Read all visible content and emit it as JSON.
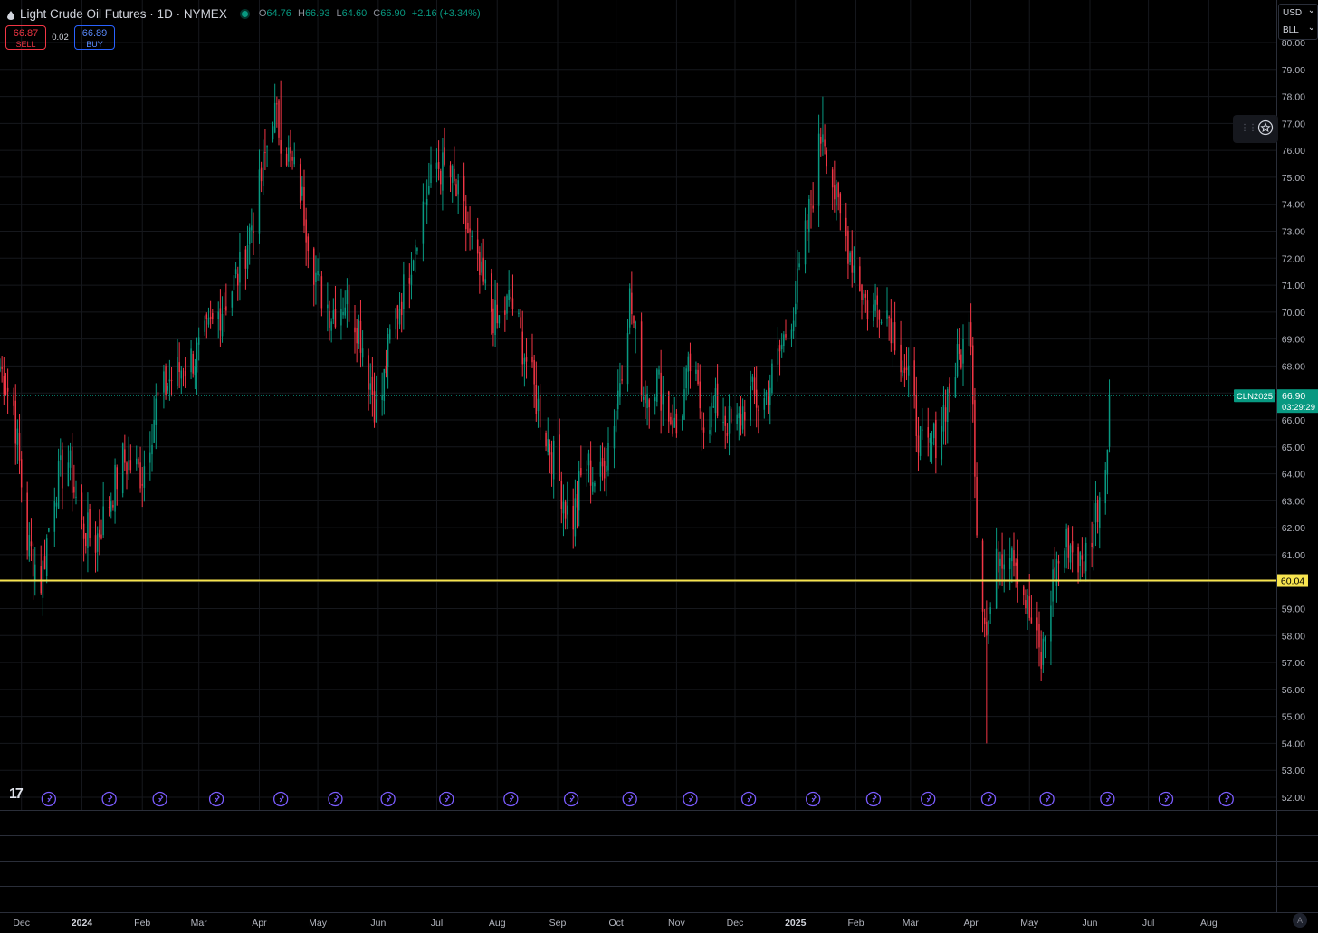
{
  "header": {
    "symbol_title": "Light Crude Oil Futures · 1D · NYMEX",
    "ohlc": {
      "o_key": "O",
      "o": "64.76",
      "h_key": "H",
      "h": "66.93",
      "l_key": "L",
      "l": "64.60",
      "c_key": "C",
      "c": "66.90",
      "change": "+2.16 (+3.34%)"
    }
  },
  "trade": {
    "sell_price": "66.87",
    "sell_label": "SELL",
    "spread": "0.02",
    "buy_price": "66.89",
    "buy_label": "BUY"
  },
  "currency": {
    "currency": "USD",
    "unit": "BLL"
  },
  "colors": {
    "up": "#089981",
    "down": "#f23645",
    "hline": "#f7e44f",
    "grid": "#16181d",
    "axis_text": "#b2b5be",
    "event": "#7b5cff",
    "label_bg": "#089981"
  },
  "chart_data": {
    "type": "candlestick",
    "y_axis": {
      "min": 52,
      "max": 80,
      "step": 1,
      "side": "right",
      "tick_labels": [
        "80.00",
        "79.00",
        "78.00",
        "77.00",
        "76.00",
        "75.00",
        "74.00",
        "73.00",
        "72.00",
        "71.00",
        "70.00",
        "69.00",
        "68.00",
        "67.00",
        "66.00",
        "65.00",
        "64.00",
        "63.00",
        "62.00",
        "61.00",
        "60.00",
        "59.00",
        "58.00",
        "57.00",
        "56.00",
        "55.00",
        "54.00",
        "53.00",
        "52.00"
      ]
    },
    "x_axis": {
      "start_date": "2023-11-20",
      "end_date": "2025-08-31",
      "tick_labels": [
        "Dec",
        "2024",
        "Feb",
        "Mar",
        "Apr",
        "May",
        "Jun",
        "Jul",
        "Aug",
        "Sep",
        "Oct",
        "Nov",
        "Dec",
        "2025",
        "Feb",
        "Mar",
        "Apr",
        "May",
        "Jun",
        "Jul",
        "Aug"
      ],
      "tick_dates": [
        "2023-12-01",
        "2024-01-01",
        "2024-02-01",
        "2024-03-01",
        "2024-04-01",
        "2024-05-01",
        "2024-06-01",
        "2024-07-01",
        "2024-08-01",
        "2024-09-01",
        "2024-10-01",
        "2024-11-01",
        "2024-12-01",
        "2025-01-01",
        "2025-02-01",
        "2025-03-01",
        "2025-04-01",
        "2025-05-01",
        "2025-06-01",
        "2025-07-01",
        "2025-08-01"
      ]
    },
    "grid": true,
    "anchor_closes": [
      [
        "2023-11-20",
        68.0
      ],
      [
        "2023-11-27",
        66.5
      ],
      [
        "2023-12-04",
        61.5
      ],
      [
        "2023-12-11",
        60.0
      ],
      [
        "2023-12-18",
        63.5
      ],
      [
        "2023-12-25",
        64.5
      ],
      [
        "2024-01-01",
        62.0
      ],
      [
        "2024-01-08",
        61.5
      ],
      [
        "2024-01-15",
        63.0
      ],
      [
        "2024-01-22",
        64.5
      ],
      [
        "2024-02-01",
        64.0
      ],
      [
        "2024-02-08",
        66.5
      ],
      [
        "2024-02-15",
        67.5
      ],
      [
        "2024-02-22",
        68.0
      ],
      [
        "2024-03-01",
        68.5
      ],
      [
        "2024-03-08",
        69.5
      ],
      [
        "2024-03-15",
        70.5
      ],
      [
        "2024-03-22",
        71.5
      ],
      [
        "2024-04-01",
        74.5
      ],
      [
        "2024-04-08",
        77.5
      ],
      [
        "2024-04-15",
        76.0
      ],
      [
        "2024-04-22",
        74.5
      ],
      [
        "2024-05-01",
        71.0
      ],
      [
        "2024-05-08",
        70.0
      ],
      [
        "2024-05-15",
        70.5
      ],
      [
        "2024-05-22",
        69.5
      ],
      [
        "2024-06-01",
        66.0
      ],
      [
        "2024-06-08",
        69.5
      ],
      [
        "2024-06-15",
        71.0
      ],
      [
        "2024-06-22",
        73.5
      ],
      [
        "2024-07-01",
        75.5
      ],
      [
        "2024-07-08",
        75.0
      ],
      [
        "2024-07-15",
        73.5
      ],
      [
        "2024-07-22",
        71.5
      ],
      [
        "2024-08-01",
        69.5
      ],
      [
        "2024-08-08",
        70.5
      ],
      [
        "2024-08-15",
        68.5
      ],
      [
        "2024-08-22",
        66.5
      ],
      [
        "2024-09-01",
        64.0
      ],
      [
        "2024-09-08",
        62.0
      ],
      [
        "2024-09-15",
        64.5
      ],
      [
        "2024-09-22",
        63.5
      ],
      [
        "2024-10-01",
        66.5
      ],
      [
        "2024-10-08",
        70.5
      ],
      [
        "2024-10-15",
        67.0
      ],
      [
        "2024-10-22",
        67.5
      ],
      [
        "2024-11-01",
        65.5
      ],
      [
        "2024-11-08",
        68.0
      ],
      [
        "2024-11-15",
        66.0
      ],
      [
        "2024-11-22",
        66.5
      ],
      [
        "2024-12-01",
        65.5
      ],
      [
        "2024-12-08",
        67.0
      ],
      [
        "2024-12-15",
        66.5
      ],
      [
        "2024-12-22",
        68.0
      ],
      [
        "2025-01-01",
        70.5
      ],
      [
        "2025-01-10",
        74.5
      ],
      [
        "2025-01-15",
        77.0
      ],
      [
        "2025-01-22",
        74.0
      ],
      [
        "2025-02-01",
        71.5
      ],
      [
        "2025-02-08",
        70.0
      ],
      [
        "2025-02-15",
        70.5
      ],
      [
        "2025-02-22",
        69.0
      ],
      [
        "2025-03-01",
        67.0
      ],
      [
        "2025-03-08",
        64.5
      ],
      [
        "2025-03-15",
        65.5
      ],
      [
        "2025-03-22",
        67.5
      ],
      [
        "2025-04-01",
        69.5
      ],
      [
        "2025-04-04",
        62.0
      ],
      [
        "2025-04-09",
        58.0
      ],
      [
        "2025-04-15",
        61.0
      ],
      [
        "2025-04-22",
        61.5
      ],
      [
        "2025-04-30",
        59.0
      ],
      [
        "2025-05-07",
        57.0
      ],
      [
        "2025-05-14",
        60.5
      ],
      [
        "2025-05-21",
        61.5
      ],
      [
        "2025-05-28",
        60.5
      ],
      [
        "2025-06-04",
        62.5
      ],
      [
        "2025-06-09",
        64.5
      ],
      [
        "2025-06-11",
        66.9
      ]
    ],
    "labeled_extremes": {
      "high_2024_apr": 78.6,
      "high_2025_jan": 78.0,
      "low_2025_apr": 54.0
    },
    "horizontal_line": {
      "value": 60.04,
      "label": "60.04"
    },
    "last_price": {
      "value": 66.9,
      "label": "66.90",
      "symbol": "CLN2025",
      "countdown": "03:29:29"
    },
    "event_markers": [
      "2023-12-15",
      "2024-01-15",
      "2024-02-10",
      "2024-03-10",
      "2024-04-12",
      "2024-05-10",
      "2024-06-06",
      "2024-07-06",
      "2024-08-08",
      "2024-09-08",
      "2024-10-08",
      "2024-11-08",
      "2024-12-08",
      "2025-01-10",
      "2025-02-10",
      "2025-03-10",
      "2025-04-10",
      "2025-05-10",
      "2025-06-10",
      "2025-07-10",
      "2025-08-10"
    ]
  },
  "footer": {
    "tv_logo": "17",
    "auto_label": "A"
  }
}
